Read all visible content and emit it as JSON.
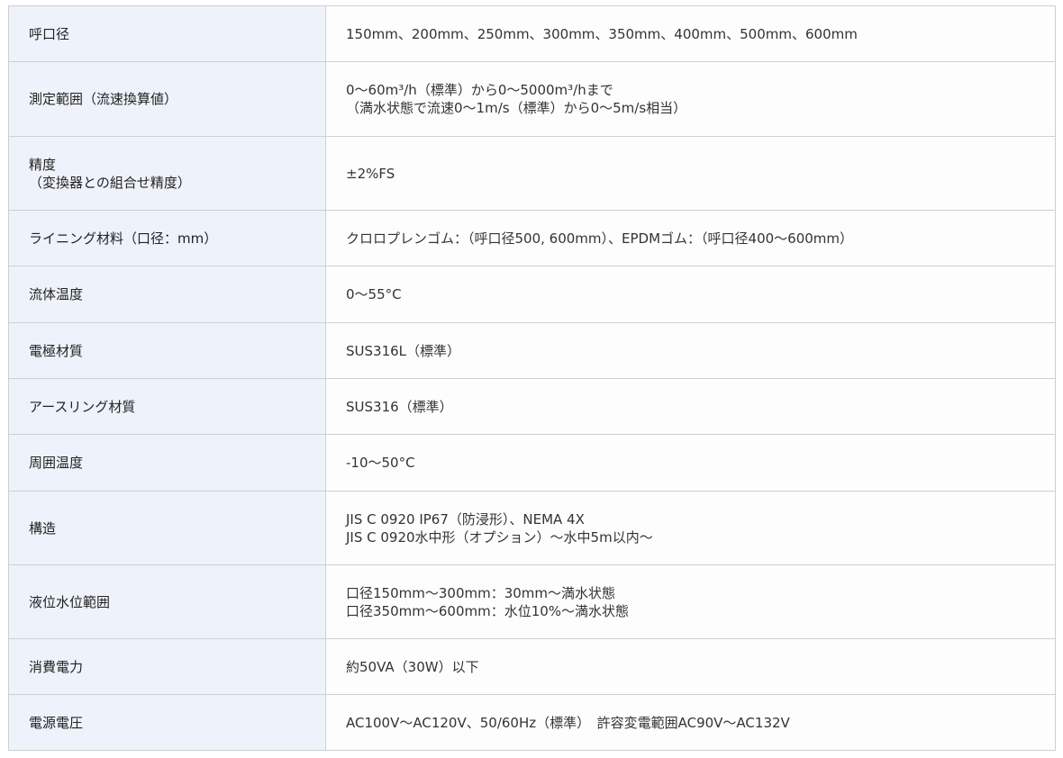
{
  "rows": [
    {
      "label": [
        "呼口径"
      ],
      "value": [
        "150mm、200mm、250mm、300mm、350mm、400mm、500mm、600mm"
      ]
    },
    {
      "label": [
        "測定範囲（流速換算値）"
      ],
      "value": [
        "0〜60m³/h（標準）から0〜5000m³/hまで",
        "（満水状態で流速0〜1m/s（標準）から0〜5m/s相当）"
      ]
    },
    {
      "label": [
        "精度",
        "（変換器との組合せ精度）"
      ],
      "value": [
        "±2%FS"
      ]
    },
    {
      "label": [
        "ライニング材料（口径：mm）"
      ],
      "value": [
        "クロロプレンゴム：（呼口径500, 600mm）、EPDMゴム：（呼口径400〜600mm）"
      ]
    },
    {
      "label": [
        "流体温度"
      ],
      "value": [
        "0〜55°C"
      ]
    },
    {
      "label": [
        "電極材質"
      ],
      "value": [
        "SUS316L（標準）"
      ]
    },
    {
      "label": [
        "アースリング材質"
      ],
      "value": [
        "SUS316（標準）"
      ]
    },
    {
      "label": [
        "周囲温度"
      ],
      "value": [
        "-10〜50°C"
      ]
    },
    {
      "label": [
        "構造"
      ],
      "value": [
        "JIS C 0920 IP67（防浸形）、NEMA 4X",
        "JIS C 0920水中形（オプション）〜水中5m以内〜"
      ]
    },
    {
      "label": [
        "液位水位範囲"
      ],
      "value": [
        "口径150mm〜300mm：30mm〜満水状態",
        "口径350mm〜600mm：水位10%〜満水状態"
      ]
    },
    {
      "label": [
        "消費電力"
      ],
      "value": [
        "約50VA（30W）以下"
      ]
    },
    {
      "label": [
        "電源電圧"
      ],
      "value": [
        "AC100V〜AC120V、50/60Hz（標準）　許容変電範囲AC90V〜AC132V"
      ]
    }
  ]
}
